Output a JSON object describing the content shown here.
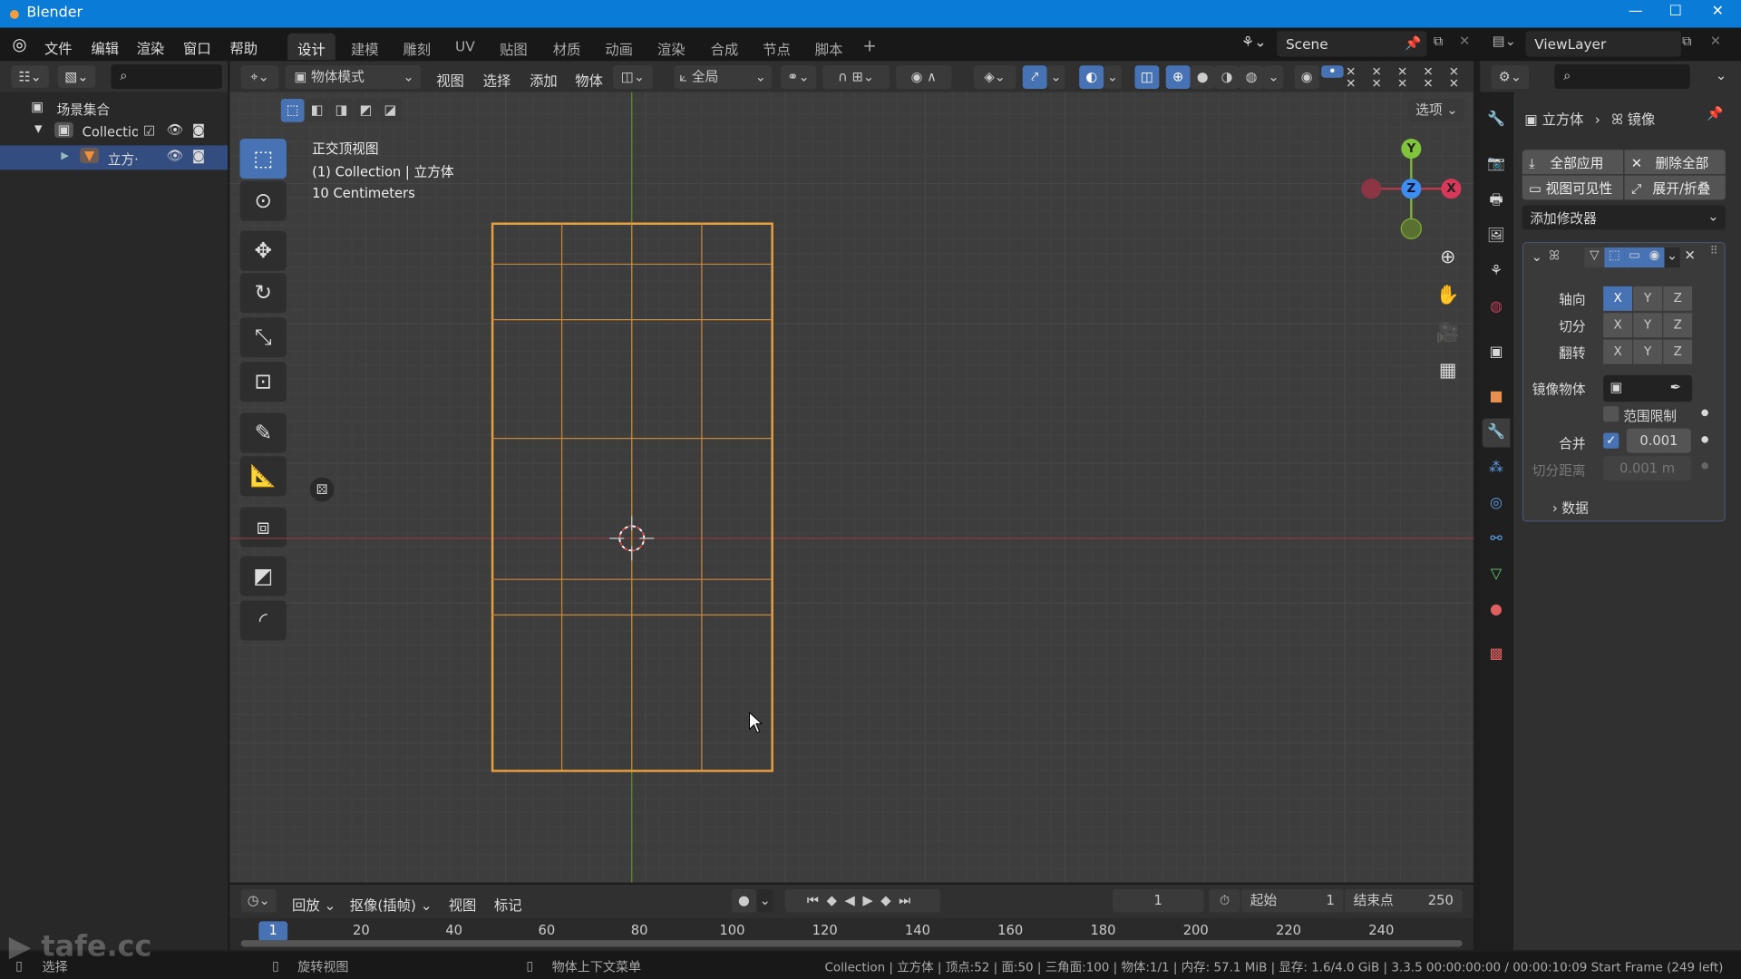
{
  "window": {
    "title": "Blender",
    "min": "—",
    "max": "☐",
    "close": "✕"
  },
  "menu": {
    "items": [
      "文件",
      "编辑",
      "渲染",
      "窗口",
      "帮助"
    ],
    "workspaces": [
      "设计",
      "建模",
      "雕刻",
      "UV",
      "贴图",
      "材质",
      "动画",
      "渲染",
      "合成",
      "节点",
      "脚本"
    ],
    "add_tab": "+",
    "active_workspace": "设计",
    "scene": "Scene",
    "view_layer": "ViewLayer"
  },
  "outliner": {
    "items": [
      {
        "label": "场景集合"
      },
      {
        "label": "Collectior"
      },
      {
        "label": "立方·"
      }
    ]
  },
  "viewport": {
    "mode": "物体模式",
    "menus": [
      "视图",
      "选择",
      "添加",
      "物体"
    ],
    "transform_orientation": "全局",
    "options": "选项",
    "overlay": {
      "view_name": "正交顶视图",
      "collection": "(1) Collection | 立方体",
      "scale": "10 Centimeters"
    },
    "gizmo": {
      "y": "Y",
      "z": "Z",
      "x": "X"
    },
    "colors": {
      "selection": "#e8a040",
      "x_axis": "#c0394f",
      "y_axis": "#7fae3a",
      "accent": "#4772b3"
    }
  },
  "properties": {
    "breadcrumb_object": "立方体",
    "breadcrumb_modifier": "镜像",
    "apply_all": "全部应用",
    "delete_all": "删除全部",
    "viewport_visibility": "视图可见性",
    "expand_collapse": "展开/折叠",
    "add_modifier": "添加修改器",
    "axis_label": "轴向",
    "bisect_label": "切分",
    "flip_label": "翻转",
    "xyz": [
      "X",
      "Y",
      "Z"
    ],
    "axis_selected": "X",
    "mirror_object_label": "镜像物体",
    "clipping": "范围限制",
    "clipping_checked": false,
    "merge_label": "合并",
    "merge_checked": true,
    "merge_value": "0.001",
    "bisect_distance_label": "切分距离",
    "bisect_distance_value": "0.001 m",
    "data_section": "数据"
  },
  "timeline": {
    "playback": "回放",
    "keying": "抠像(插帧)",
    "view": "视图",
    "marker": "标记",
    "current_frame": "1",
    "start_label": "起始",
    "start": "1",
    "end_label": "结束点",
    "end": "250",
    "ticks": [
      "1",
      "20",
      "40",
      "60",
      "80",
      "100",
      "120",
      "140",
      "160",
      "180",
      "200",
      "220",
      "240"
    ]
  },
  "status": {
    "select": "选择",
    "rotate_view": "旋转视图",
    "context_menu": "物体上下文菜单",
    "info": "Collection | 立方体 | 顶点:52 | 面:50 | 三角面:100 | 物体:1/1 | 内存: 57.1 MiB | 显存: 1.6/4.0 GiB | 3.3.5  00:00:00:00 / 00:00:10:09  Start Frame (249 left)"
  },
  "watermark": "tafe.cc"
}
